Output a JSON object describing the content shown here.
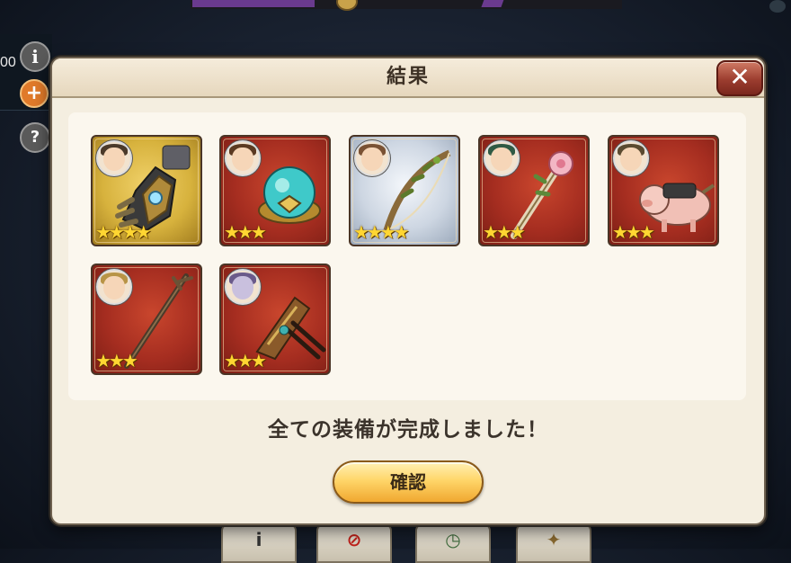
{
  "hud": {
    "left_value": "00"
  },
  "dialog": {
    "title": "結果",
    "message": "全ての装備が完成しました！",
    "confirm_label": "確認",
    "close_glyph": "✕"
  },
  "items": [
    {
      "name": "gauntlet",
      "rarity": "gold",
      "stars": "★★★★",
      "star_count": 4
    },
    {
      "name": "orb",
      "rarity": "red",
      "stars": "★★★",
      "star_count": 3
    },
    {
      "name": "bow",
      "rarity": "silver",
      "stars": "★★★★",
      "star_count": 4
    },
    {
      "name": "rose-staff",
      "rarity": "red",
      "stars": "★★★",
      "star_count": 3
    },
    {
      "name": "pig-mount",
      "rarity": "red",
      "stars": "★★★",
      "star_count": 3
    },
    {
      "name": "long-staff",
      "rarity": "red",
      "stars": "★★★",
      "star_count": 3
    },
    {
      "name": "hair-ornament",
      "rarity": "red",
      "stars": "★★★",
      "star_count": 3
    }
  ],
  "colors": {
    "gold_frame": "#d7b23d",
    "red_frame": "#a52d20",
    "silver_frame": "#cdd6e2",
    "star": "#ffd632",
    "confirm_button": "#ffd66a",
    "close_button": "#9c3d2f"
  },
  "icons": {
    "info": "info-icon",
    "plus": "plus-icon",
    "help": "help-icon",
    "close": "close-icon"
  }
}
